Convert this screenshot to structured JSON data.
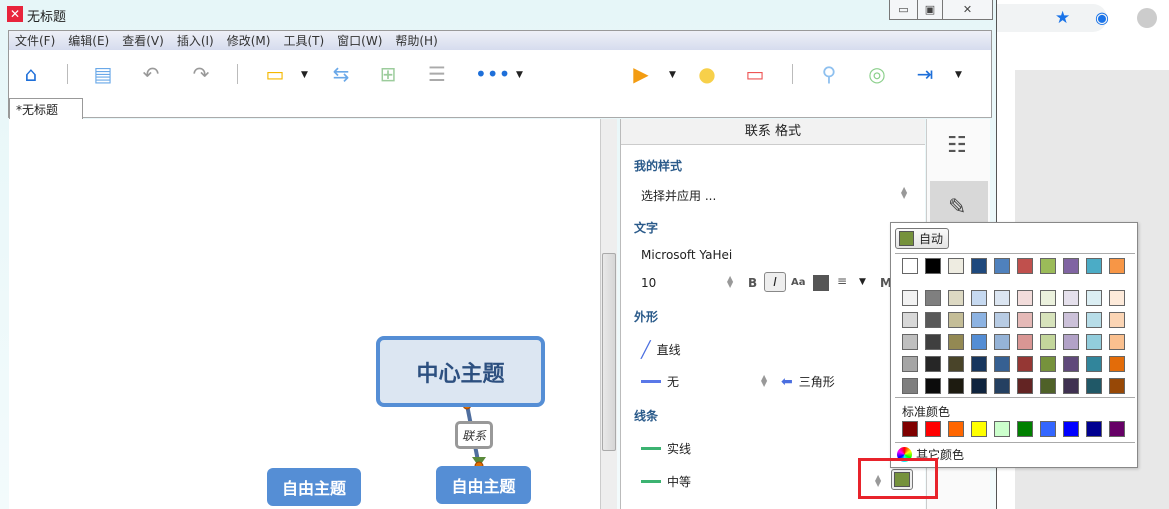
{
  "window": {
    "title": "无标题",
    "controls": {
      "minimize": "▭",
      "restore": "▣",
      "close": "✕"
    }
  },
  "menu": [
    "文件(F)",
    "编辑(E)",
    "查看(V)",
    "插入(I)",
    "修改(M)",
    "工具(T)",
    "窗口(W)",
    "帮助(H)"
  ],
  "tab": {
    "label": "*无标题"
  },
  "canvas": {
    "central_topic": "中心主题",
    "floating_topics": [
      "自由主题",
      "自由主题"
    ],
    "relationship_label": "联系"
  },
  "panel": {
    "title": "联系 格式",
    "my_style": {
      "label": "我的样式",
      "value": "选择并应用 ..."
    },
    "text": {
      "label": "文字",
      "font": "Microsoft YaHei",
      "size": "10",
      "bold": "B",
      "italic": "I",
      "case": "Aa",
      "more": "M"
    },
    "shape": {
      "label": "外形",
      "line_shape": "直线",
      "start_arrow": "无",
      "end_arrow": "三角形"
    },
    "line": {
      "label": "线条",
      "pattern": "实线",
      "width": "中等",
      "color": "#76923c"
    }
  },
  "color_popup": {
    "auto_label": "自动",
    "auto_color": "#76923c",
    "theme_top": [
      "#ffffff",
      "#000000",
      "#eeece1",
      "#1f497d",
      "#4f81bd",
      "#c0504d",
      "#9bbb59",
      "#8064a2",
      "#4bacc6",
      "#f79646"
    ],
    "theme_shades": [
      [
        "#f2f2f2",
        "#7f7f7f",
        "#ddd9c3",
        "#c6d9f0",
        "#dbe5f1",
        "#f2dcdb",
        "#ebf1dd",
        "#e5e0ec",
        "#dbeef3",
        "#fdeada"
      ],
      [
        "#d8d8d8",
        "#595959",
        "#c4bd97",
        "#8db3e2",
        "#b8cce4",
        "#e5b9b7",
        "#d7e3bc",
        "#ccc1d9",
        "#b7dde8",
        "#fbd5b5"
      ],
      [
        "#bfbfbf",
        "#3f3f3f",
        "#938953",
        "#548dd4",
        "#95b3d7",
        "#d99694",
        "#c3d69b",
        "#b2a2c7",
        "#92cddc",
        "#fac08f"
      ],
      [
        "#a5a5a5",
        "#262626",
        "#494429",
        "#17365d",
        "#366092",
        "#953734",
        "#76923c",
        "#5f497a",
        "#31859b",
        "#e36c09"
      ],
      [
        "#7f7f7f",
        "#0c0c0c",
        "#1d1b10",
        "#0f243e",
        "#244061",
        "#632423",
        "#4f6128",
        "#3f3151",
        "#205867",
        "#974806"
      ]
    ],
    "standard_label": "标准颜色",
    "standard": [
      "#7f0000",
      "#ff0000",
      "#ff6600",
      "#ffff00",
      "#ccffcc",
      "#008000",
      "#3366ff",
      "#0000ff",
      "#000090",
      "#660066"
    ],
    "more_label": "其它颜色"
  }
}
